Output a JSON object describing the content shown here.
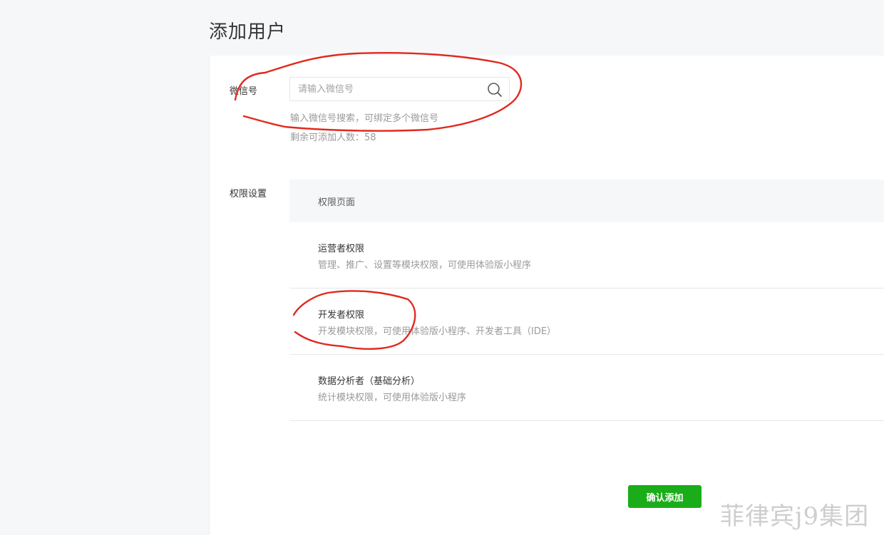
{
  "page_title": "添加用户",
  "wechat": {
    "label": "微信号",
    "placeholder": "请输入微信号",
    "value": "",
    "hint": "输入微信号搜索，可绑定多个微信号",
    "remaining": "剩余可添加人数：58"
  },
  "permissions": {
    "label": "权限设置",
    "header": "权限页面",
    "items": [
      {
        "name": "运营者权限",
        "description": "管理、推广、设置等模块权限，可使用体验版小程序"
      },
      {
        "name": "开发者权限",
        "description": "开发模块权限，可使用体验版小程序、开发者工具（IDE）"
      },
      {
        "name": "数据分析者（基础分析）",
        "description": "统计模块权限，可使用体验版小程序"
      }
    ]
  },
  "confirm_label": "确认添加",
  "watermark": "菲律宾j9集团",
  "colors": {
    "accent": "#1aad19",
    "annotation": "#e02a1e",
    "panel": "#ffffff",
    "background": "#f6f7f9"
  },
  "icons": {
    "search": "search-icon"
  }
}
